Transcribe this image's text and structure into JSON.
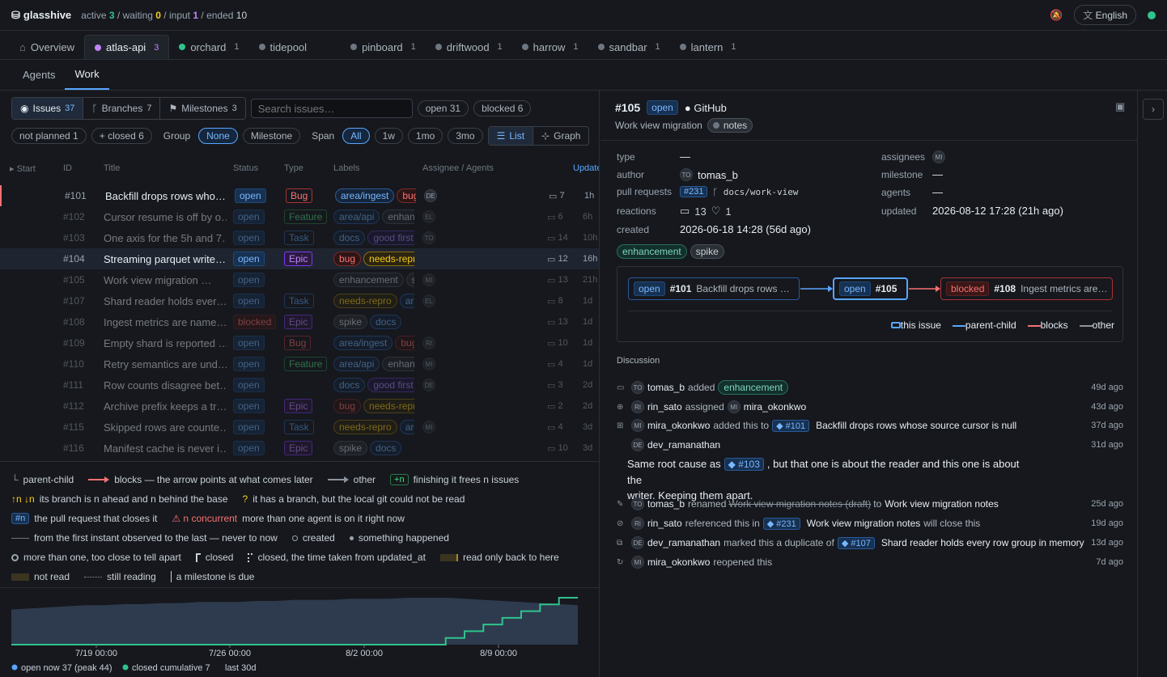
{
  "top": {
    "brand": "glasshive",
    "active_label": "active",
    "active": "3",
    "waiting_label": "waiting",
    "waiting": "0",
    "input_label": "input",
    "input": "1",
    "ended_label": "ended",
    "ended": "10",
    "lang": "English"
  },
  "projects": [
    {
      "name": "Overview",
      "count": "",
      "color": "",
      "icon": "home-icon"
    },
    {
      "name": "atlas-api",
      "count": "3",
      "color": "#c084fc"
    },
    {
      "name": "orchard",
      "count": "1",
      "color": "#2fc48d"
    },
    {
      "name": "tidepool",
      "count": "",
      "color": "#6e7681"
    },
    {
      "name": "pinboard",
      "count": "1",
      "color": "#6e7681"
    },
    {
      "name": "driftwood",
      "count": "1",
      "color": "#6e7681"
    },
    {
      "name": "harrow",
      "count": "1",
      "color": "#6e7681"
    },
    {
      "name": "sandbar",
      "count": "1",
      "color": "#6e7681"
    },
    {
      "name": "lantern",
      "count": "1",
      "color": "#6e7681"
    }
  ],
  "subtabs": [
    "Agents",
    "Work"
  ],
  "filters": {
    "issues": "Issues",
    "issues_n": "37",
    "branches": "Branches",
    "branches_n": "7",
    "milestones": "Milestones",
    "milestones_n": "3",
    "search_placeholder": "Search issues…",
    "open": "open 31",
    "blocked": "blocked 6",
    "not_planned": "not planned 1",
    "closed": "+ closed 6",
    "group_label": "Group",
    "group_none": "None",
    "group_milestone": "Milestone",
    "span_label": "Span",
    "span": [
      "All",
      "1w",
      "1mo",
      "3mo"
    ],
    "list": "List",
    "graph": "Graph"
  },
  "columns": {
    "start": "Start",
    "id": "ID",
    "title": "Title",
    "status": "Status",
    "type": "Type",
    "labels": "Labels",
    "assignee": "Assignee / Agents",
    "updated": "Updated"
  },
  "rows": [
    {
      "id": "#101",
      "title": "Backfill drops rows who…",
      "status": "open",
      "type": "Bug",
      "labels": [
        [
          "area/ingest",
          "area"
        ],
        [
          "bug",
          "bug"
        ]
      ],
      "assign": "DE",
      "comments": "7",
      "upd": "1h",
      "dim": false,
      "sel": false
    },
    {
      "id": "#102",
      "title": "Cursor resume is off by o…",
      "status": "open",
      "type": "Feature",
      "labels": [
        [
          "area/api",
          "area"
        ],
        [
          "enhancement",
          "enh"
        ]
      ],
      "assign": "EL",
      "comments": "6",
      "upd": "6h",
      "dim": true,
      "sel": false
    },
    {
      "id": "#103",
      "title": "One axis for the 5h and 7…",
      "status": "open",
      "type": "Task",
      "labels": [
        [
          "docs",
          "docs"
        ],
        [
          "good first",
          "good"
        ]
      ],
      "assign": "TO",
      "comments": "14",
      "upd": "10h",
      "dim": true,
      "sel": false
    },
    {
      "id": "#104",
      "title": "Streaming parquet write…",
      "status": "open",
      "type": "Epic",
      "labels": [
        [
          "bug",
          "bug"
        ],
        [
          "needs-repro",
          "needs"
        ]
      ],
      "assign": "",
      "comments": "12",
      "upd": "16h",
      "dim": false,
      "sel": true
    },
    {
      "id": "#105",
      "title": "Work view migration …",
      "status": "open",
      "type": "",
      "labels": [
        [
          "enhancement",
          "enh"
        ],
        [
          "spike",
          "spike"
        ]
      ],
      "assign": "MI",
      "comments": "13",
      "upd": "21h",
      "dim": true,
      "sel": false
    },
    {
      "id": "#107",
      "title": "Shard reader holds ever…",
      "status": "open",
      "type": "Task",
      "labels": [
        [
          "needs-repro",
          "needs"
        ],
        [
          "area",
          "area"
        ]
      ],
      "assign": "EL",
      "comments": "8",
      "upd": "1d",
      "dim": true,
      "sel": false
    },
    {
      "id": "#108",
      "title": "Ingest metrics are name…",
      "status": "blocked",
      "type": "Epic",
      "labels": [
        [
          "spike",
          "spike"
        ],
        [
          "docs",
          "docs"
        ]
      ],
      "assign": "",
      "comments": "13",
      "upd": "1d",
      "dim": true,
      "sel": false
    },
    {
      "id": "#109",
      "title": "Empty shard is reported …",
      "status": "open",
      "type": "Bug",
      "labels": [
        [
          "area/ingest",
          "area"
        ],
        [
          "bug",
          "bug"
        ]
      ],
      "assign": "RI",
      "comments": "10",
      "upd": "1d",
      "dim": true,
      "sel": false
    },
    {
      "id": "#110",
      "title": "Retry semantics are und…",
      "status": "open",
      "type": "Feature",
      "labels": [
        [
          "area/api",
          "area"
        ],
        [
          "enhancement",
          "enh"
        ]
      ],
      "assign": "MI",
      "comments": "4",
      "upd": "1d",
      "dim": true,
      "sel": false
    },
    {
      "id": "#111",
      "title": "Row counts disagree bet…",
      "status": "open",
      "type": "",
      "labels": [
        [
          "docs",
          "docs"
        ],
        [
          "good first",
          "good"
        ]
      ],
      "assign": "DE",
      "comments": "3",
      "upd": "2d",
      "dim": true,
      "sel": false
    },
    {
      "id": "#112",
      "title": "Archive prefix keeps a tr…",
      "status": "open",
      "type": "Epic",
      "labels": [
        [
          "bug",
          "bug"
        ],
        [
          "needs-repro",
          "needs"
        ]
      ],
      "assign": "",
      "comments": "2",
      "upd": "2d",
      "dim": true,
      "sel": false
    },
    {
      "id": "#115",
      "title": "Skipped rows are counte…",
      "status": "open",
      "type": "Task",
      "labels": [
        [
          "needs-repro",
          "needs"
        ],
        [
          "area",
          "area"
        ]
      ],
      "assign": "MI",
      "comments": "4",
      "upd": "3d",
      "dim": true,
      "sel": false
    },
    {
      "id": "#116",
      "title": "Manifest cache is never i…",
      "status": "open",
      "type": "Epic",
      "labels": [
        [
          "spike",
          "spike"
        ],
        [
          "docs",
          "docs"
        ]
      ],
      "assign": "",
      "comments": "10",
      "upd": "3d",
      "dim": true,
      "sel": false
    }
  ],
  "legend": {
    "parent_child": "parent-child",
    "blocks": "blocks — the arrow points at what comes later",
    "other": "other",
    "plus_n": "+n",
    "frees": "finishing it frees n issues",
    "ahead_sym": "↑n ↓n",
    "ahead": "its branch is n ahead and n behind the base",
    "q_sym": "?",
    "unread": "it has a branch, but the local git could not be read",
    "pr_sym": "#n",
    "pr": "the pull request that closes it",
    "conc_sym": "⚠ n concurrent",
    "conc": "more than one agent is on it right now",
    "span": "from the first instant observed to the last — never to now",
    "created": "created",
    "happened": "something happened",
    "cluster": "more than one, too close to tell apart",
    "closed": "closed",
    "closed_est": "closed, the time taken from updated_at",
    "readback": "read only back to here",
    "notread": "not read",
    "stillreading": "still reading",
    "milestone": "a milestone is due"
  },
  "chart_data": {
    "type": "area",
    "x": [
      "7/19 00:00",
      "7/26 00:00",
      "8/2 00:00",
      "8/9 00:00"
    ],
    "xticks": [
      "7/19 00:00",
      "7/26 00:00",
      "8/2 00:00",
      "8/9 00:00"
    ],
    "series": [
      {
        "name": "open now 37 (peak 44)",
        "color": "#2e3b4e",
        "values": [
          33,
          34,
          35,
          36,
          37,
          37,
          38,
          38,
          39,
          39,
          40,
          40,
          40,
          41,
          41,
          42,
          42,
          42,
          43,
          43,
          43,
          44,
          44,
          44,
          43,
          42,
          41,
          40,
          39,
          38,
          37
        ]
      },
      {
        "name": "closed cumulative 7",
        "color": "#2fc48d",
        "values": [
          0,
          0,
          0,
          0,
          0,
          0,
          0,
          0,
          0,
          0,
          0,
          0,
          0,
          0,
          0,
          0,
          0,
          0,
          0,
          0,
          0,
          0,
          0,
          1,
          2,
          3,
          4,
          5,
          6,
          7,
          7
        ]
      }
    ],
    "note": "last 30d",
    "ylim": [
      0,
      44
    ]
  },
  "detail": {
    "num": "#105",
    "status": "open",
    "source": "GitHub",
    "title": "Work view migration",
    "label_notes": "notes",
    "type_k": "type",
    "type_v": "—",
    "author_k": "author",
    "author_v": "tomas_b",
    "author_av": "TO",
    "pr_k": "pull requests",
    "pr_v": "#231",
    "pr_branch": "docs/work-view",
    "react_k": "reactions",
    "react_comments": "13",
    "react_hearts": "1",
    "created_k": "created",
    "created_v": "2026-06-18 14:28 (56d ago)",
    "assignees_k": "assignees",
    "assignees_v": "MI",
    "milestone_k": "milestone",
    "milestone_v": "—",
    "agents_k": "agents",
    "agents_v": "—",
    "updated_k": "updated",
    "updated_v": "2026-08-12 17:28 (21h ago)",
    "tags": [
      "enhancement",
      "spike"
    ],
    "graph": {
      "n1_status": "open",
      "n1_num": "#101",
      "n1_title": "Backfill drops rows …",
      "n2_status": "open",
      "n2_num": "#105",
      "n3_status": "blocked",
      "n3_num": "#108",
      "n3_title": "Ingest metrics are…",
      "leg_this": "this issue",
      "leg_pc": "parent-child",
      "leg_blocks": "blocks",
      "leg_other": "other"
    },
    "discussion": "Discussion",
    "events": [
      {
        "av": "TO",
        "who": "tomas_b",
        "text": "added",
        "tag": "enhancement",
        "ago": "49d ago"
      },
      {
        "av": "RI",
        "who": "rin_sato",
        "text": "assigned",
        "av2": "MI",
        "who2": "mira_okonkwo",
        "ago": "43d ago"
      },
      {
        "av": "MI",
        "who": "mira_okonkwo",
        "text": "added this to",
        "ref": "◆ #101",
        "tail": "Backfill drops rows whose source cursor is null",
        "ago": "37d ago"
      },
      {
        "av": "DE",
        "who": "dev_ramanathan",
        "ago": "31d ago",
        "comment1": "Same root cause as",
        "ref": "◆ #103",
        "comment2": ", but that one is about the reader and this one is about the",
        "comment3": "writer. Keeping them apart."
      },
      {
        "av": "TO",
        "who": "tomas_b",
        "text": "renamed",
        "old": "Work view migration notes (draft)",
        "mid": "to",
        "tail": "Work view migration notes",
        "ago": "25d ago"
      },
      {
        "av": "RI",
        "who": "rin_sato",
        "text": "referenced this in",
        "ref": "◆ #231",
        "tail": "Work view migration notes",
        "tail2": "will close this",
        "ago": "19d ago"
      },
      {
        "av": "DE",
        "who": "dev_ramanathan",
        "text": "marked this a duplicate of",
        "ref": "◆ #107",
        "tail": "Shard reader holds every row group in memory",
        "ago": "13d ago"
      },
      {
        "av": "MI",
        "who": "mira_okonkwo",
        "text": "reopened this",
        "ago": "7d ago"
      }
    ]
  }
}
